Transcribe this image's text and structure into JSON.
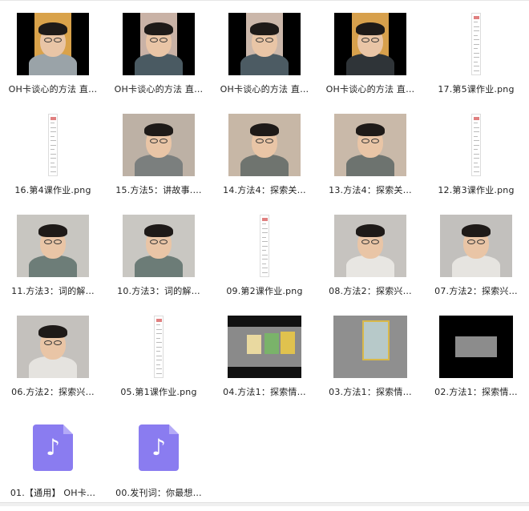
{
  "files": [
    {
      "label": "OH卡谈心的方法 直…",
      "kind": "video-pillar",
      "bg": "#d9a24a",
      "shirt": "#9aa3a8"
    },
    {
      "label": "OH卡谈心的方法 直…",
      "kind": "video-pillar",
      "bg": "#c9b2a6",
      "shirt": "#4a5a62"
    },
    {
      "label": "OH卡谈心的方法 直…",
      "kind": "video-pillar",
      "bg": "#cbb7aa",
      "shirt": "#4c5b63"
    },
    {
      "label": "OH卡谈心的方法 直…",
      "kind": "video-pillar",
      "bg": "#d7a04c",
      "shirt": "#2f3438"
    },
    {
      "label": "17.第5课作业.png",
      "kind": "doc"
    },
    {
      "label": "16.第4课作业.png",
      "kind": "doc"
    },
    {
      "label": "15.方法5：讲故事.…",
      "kind": "video-wide",
      "bg": "#bdb1a5",
      "shirt": "#7b7f7e"
    },
    {
      "label": "14.方法4：探索关…",
      "kind": "video-wide",
      "bg": "#c7b7a6",
      "shirt": "#6f746f"
    },
    {
      "label": "13.方法4：探索关…",
      "kind": "video-wide",
      "bg": "#c9b9a9",
      "shirt": "#6d736f"
    },
    {
      "label": "12.第3课作业.png",
      "kind": "doc"
    },
    {
      "label": "11.方法3：词的解…",
      "kind": "video-wide",
      "bg": "#c8c6c1",
      "shirt": "#6d7d78"
    },
    {
      "label": "10.方法3：词的解…",
      "kind": "video-wide",
      "bg": "#c9c7c2",
      "shirt": "#6c7c77"
    },
    {
      "label": "09.第2课作业.png",
      "kind": "doc"
    },
    {
      "label": "08.方法2：探索兴…",
      "kind": "video-wide",
      "bg": "#c6c3bf",
      "shirt": "#e8e6e2"
    },
    {
      "label": "07.方法2：探索兴…",
      "kind": "video-wide",
      "bg": "#c2c0bd",
      "shirt": "#e6e4e0"
    },
    {
      "label": "06.方法2：探索兴…",
      "kind": "video-wide",
      "bg": "#c4c1bd",
      "shirt": "#e5e3df"
    },
    {
      "label": "05.第1课作业.png",
      "kind": "doc"
    },
    {
      "label": "04.方法1：探索情…",
      "kind": "photo-cards",
      "bg": "#8a8a8a"
    },
    {
      "label": "03.方法1：探索情…",
      "kind": "photo-card",
      "bg": "#8f8f8f"
    },
    {
      "label": "02.方法1：探索情…",
      "kind": "photo-dark",
      "bg": "#000000"
    },
    {
      "label": "01.【通用】 OH卡…",
      "kind": "audio",
      "icon": "music-note-icon",
      "color": "#8a7cf0"
    },
    {
      "label": "00.发刊词：你最想…",
      "kind": "audio",
      "icon": "music-note-icon",
      "color": "#8a7cf0"
    }
  ]
}
